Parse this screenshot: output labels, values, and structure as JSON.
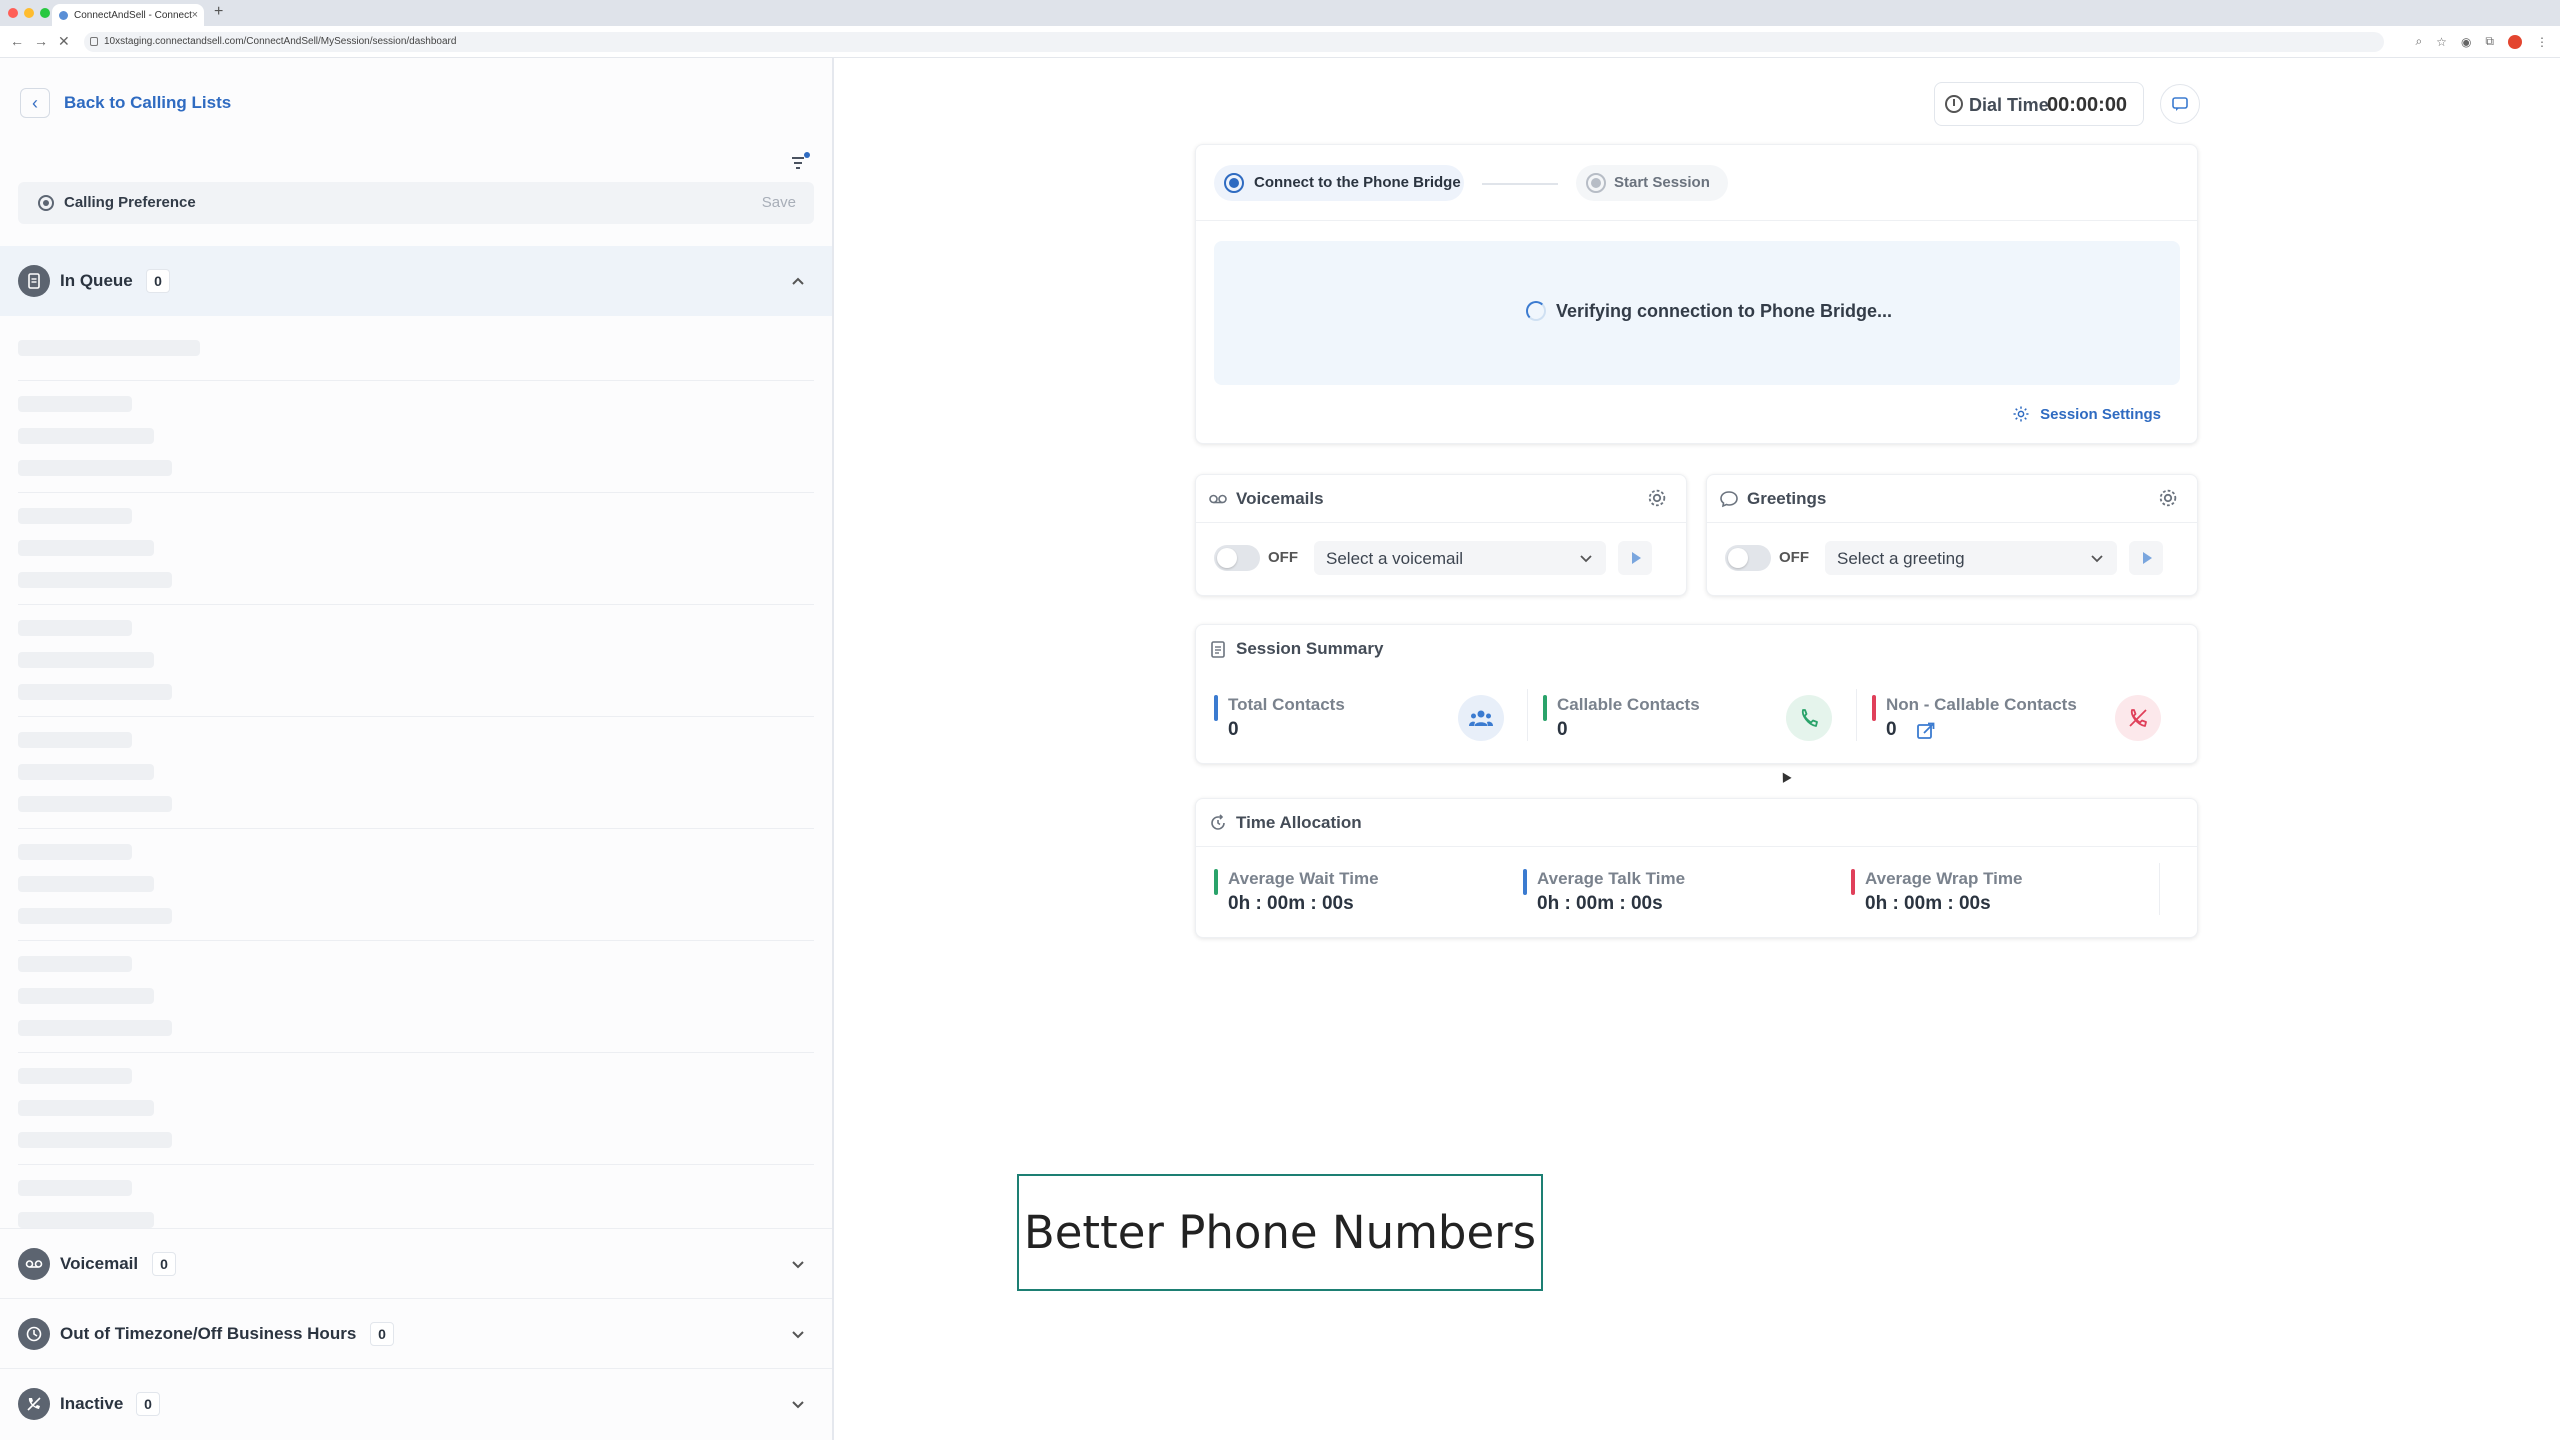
{
  "browser": {
    "tab_title": "ConnectAndSell - Connect",
    "url": "10xstaging.connectandsell.com/ConnectAndSell/MySession/session/dashboard"
  },
  "left": {
    "back_label": "Back to Calling Lists",
    "preference_label": "Calling Preference",
    "save_label": "Save",
    "sections": [
      {
        "title": "In Queue",
        "count": "0",
        "icon": "document-icon",
        "expanded": true
      },
      {
        "title": "Voicemail",
        "count": "0",
        "icon": "voicemail-icon",
        "expanded": false
      },
      {
        "title": "Out of Timezone/Off Business Hours",
        "count": "0",
        "icon": "clock-icon",
        "expanded": false
      },
      {
        "title": "Inactive",
        "count": "0",
        "icon": "no-phone-icon",
        "expanded": false
      }
    ]
  },
  "header": {
    "dial_time_label": "Dial Time",
    "dial_time_value": "00:00:00"
  },
  "bridge": {
    "step1": "Connect to the Phone Bridge",
    "step2": "Start Session",
    "verifying_text": "Verifying connection to Phone Bridge...",
    "session_settings": "Session Settings"
  },
  "voicemails": {
    "title": "Voicemails",
    "toggle_state": "OFF",
    "select_value": "Select a voicemail"
  },
  "greetings": {
    "title": "Greetings",
    "toggle_state": "OFF",
    "select_value": "Select a greeting"
  },
  "summary": {
    "title": "Session Summary",
    "total_label": "Total Contacts",
    "total_value": "0",
    "callable_label": "Callable Contacts",
    "callable_value": "0",
    "noncallable_label": "Non - Callable Contacts",
    "noncallable_value": "0"
  },
  "time_allocation": {
    "title": "Time Allocation",
    "wait_label": "Average Wait Time",
    "wait_value": "0h : 00m : 00s",
    "talk_label": "Average Talk Time",
    "talk_value": "0h : 00m : 00s",
    "wrap_label": "Average Wrap Time",
    "wrap_value": "0h : 00m : 00s"
  },
  "caption": "Better Phone Numbers",
  "colors": {
    "accent_blue": "#2f6bc1",
    "bar_blue": "#3b7bd0",
    "bar_green": "#2aa36a",
    "bar_red": "#e0405a"
  }
}
